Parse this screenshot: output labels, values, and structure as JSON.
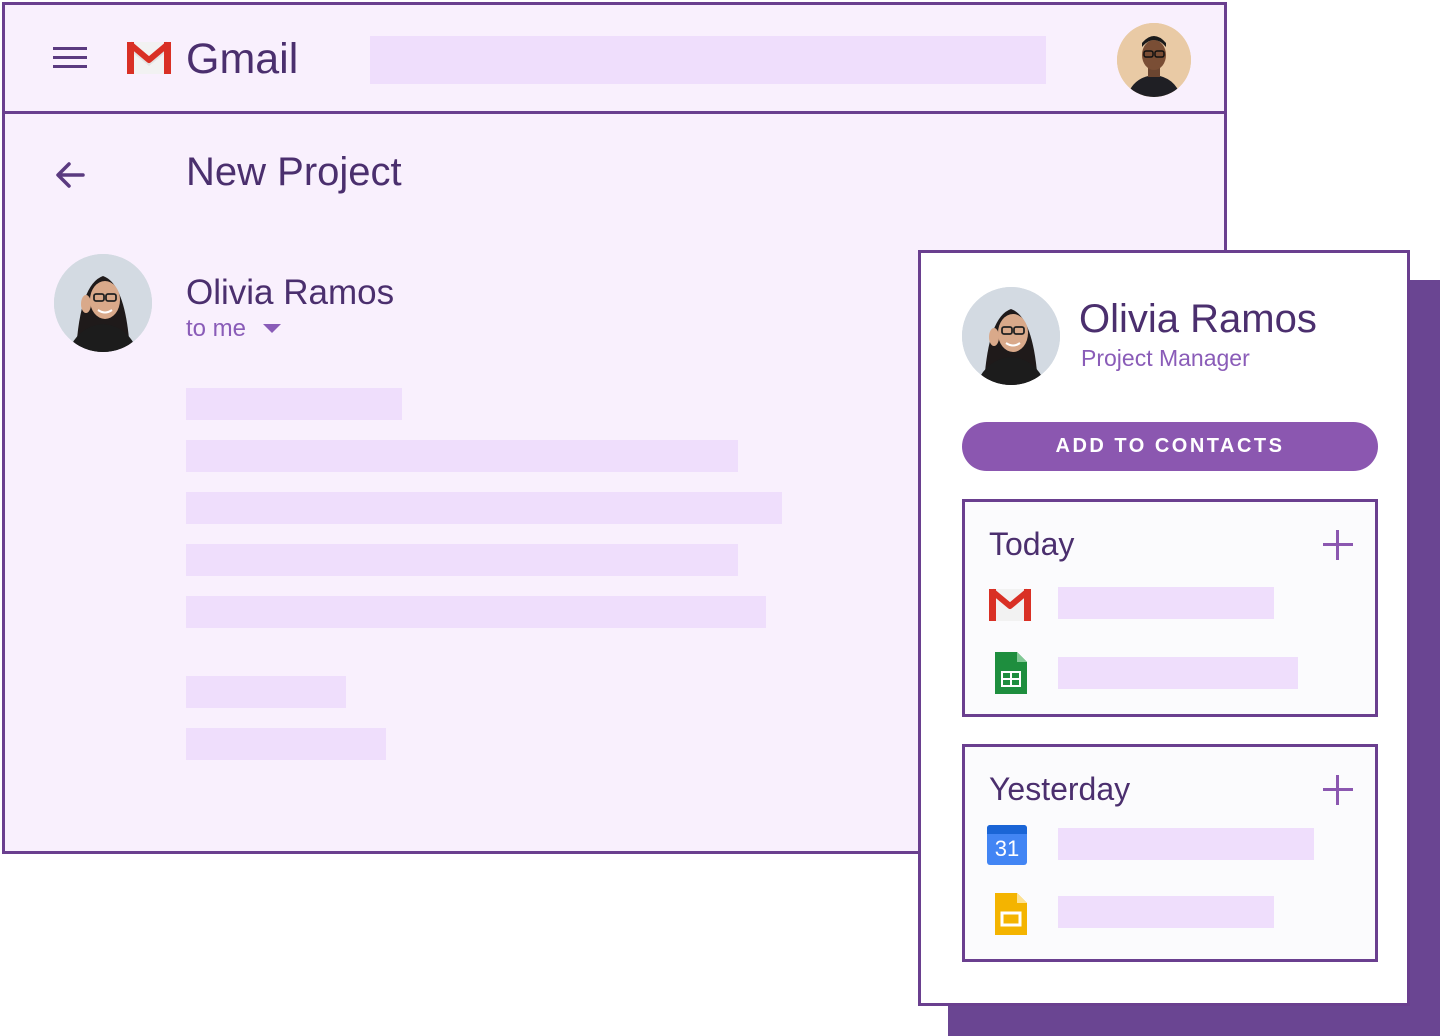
{
  "header": {
    "app_title": "Gmail",
    "menu_icon": "hamburger-menu-icon",
    "logo_icon": "gmail-logo-icon"
  },
  "email": {
    "subject": "New Project",
    "sender_name": "Olivia Ramos",
    "recipient_text": "to me"
  },
  "contact_card": {
    "name": "Olivia Ramos",
    "title": "Project Manager",
    "add_button_label": "ADD TO CONTACTS",
    "sections": [
      {
        "label": "Today",
        "items": [
          {
            "icon": "gmail-icon"
          },
          {
            "icon": "google-sheets-icon"
          }
        ]
      },
      {
        "label": "Yesterday",
        "items": [
          {
            "icon": "google-calendar-icon",
            "icon_text": "31"
          },
          {
            "icon": "google-slides-icon"
          }
        ]
      }
    ]
  },
  "colors": {
    "accent": "#8b57b0",
    "border": "#6a3f8f",
    "background": "#f9f0fd",
    "placeholder": "#efdefc",
    "text": "#4b2f6e"
  }
}
